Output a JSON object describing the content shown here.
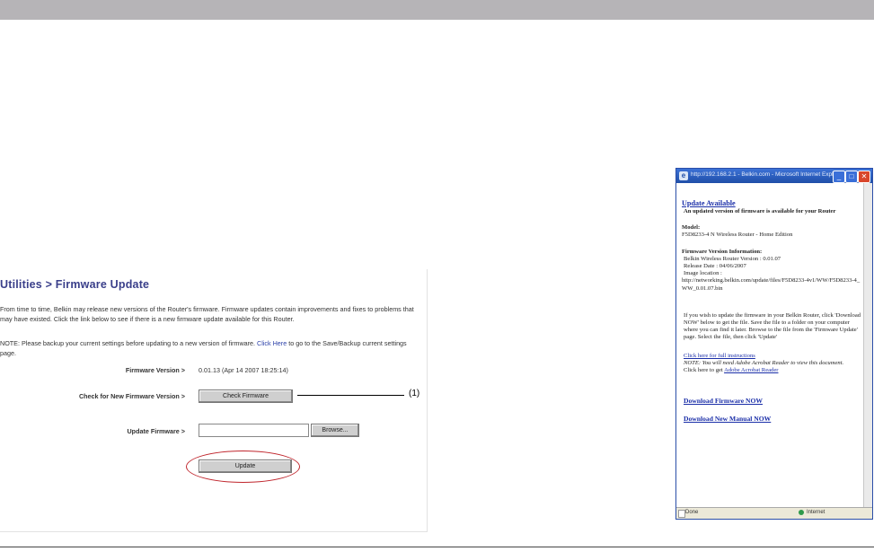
{
  "firmware_page": {
    "title": "Utilities > Firmware Update",
    "description": "From time to time, Belkin may release new versions of the Router's firmware. Firmware updates contain improvements and fixes to problems that may have existed. Click the link below to see if there is a new firmware update available for this Router.",
    "note_prefix": "NOTE: Please backup your current settings before updating to a new version of firmware.",
    "note_link": "Click Here",
    "note_suffix": "to go to the Save/Backup current settings page.",
    "firmware_version_label": "Firmware Version >",
    "firmware_version_value": "0.01.13 (Apr 14 2007 18:25:14)",
    "check_label": "Check for New Firmware Version >",
    "check_button": "Check Firmware",
    "update_label": "Update Firmware >",
    "browse_button": "Browse...",
    "update_button": "Update"
  },
  "callout": {
    "label": "(1)"
  },
  "popup": {
    "title": "http://192.168.2.1 - Belkin.com - Microsoft Internet Explorer",
    "update_available": "Update Available",
    "intro": "An updated version of firmware is available for your Router",
    "model_label": "Model:",
    "model_value": "F5D8233-4 N Wireless Router - Home Edition",
    "version_info_label": "Firmware Version Information:",
    "router_version": "Belkin Wireless Router Version : 0.01.07",
    "release_date": "Release Date : 04/06/2007",
    "image_location_label": "Image location :",
    "image_location_url": "http://networking.belkin.com/update/files/F5D8233-4v1/WW/F5D8233-4_WW_0.01.07.bin",
    "instructions": "If you wish to update the firmware in your Belkin Router, click 'Download NOW' below to get the file. Save the file to a folder on your computer where you can find it later. Browse to the file from the 'Firmware Update' page. Select the file, then click 'Update'",
    "full_instructions_link": "Click here for full instructions",
    "acrobat_note": "NOTE: You will need Adobe Acrobat Reader to view this document.",
    "acrobat_prefix": "Click here to get",
    "acrobat_link": "Adobe Acrobat Reader",
    "download_firmware": "Download Firmware NOW",
    "download_manual": "Download New Manual NOW",
    "status_done": "Done",
    "status_zone": "Internet",
    "accent_color": "#1f4ea8"
  }
}
